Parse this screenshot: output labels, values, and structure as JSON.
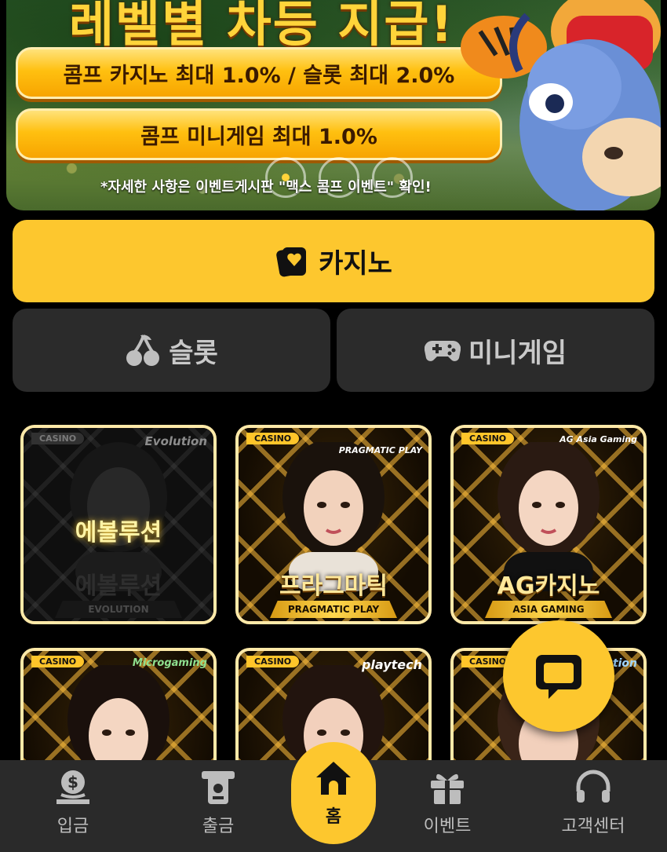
{
  "banner": {
    "title": "레벨별 차등 지급!",
    "pill_1": "콤프 카지노 최대 1.0% / 슬롯 최대 2.0%",
    "pill_2": "콤프 미니게임 최대 1.0%",
    "note": "*자세한 사항은 이벤트게시판 \"맥스 콤프 이벤트\" 확인!",
    "slide_count": 3,
    "active_slide": 1
  },
  "categories": {
    "casino": "카지노",
    "slot": "슬롯",
    "minigame": "미니게임"
  },
  "cards": [
    {
      "tag": "CASINO",
      "brand": "Evolution",
      "overlay": "에볼루션",
      "kname": "에볼루션",
      "ename": "EVOLUTION",
      "dimmed": true
    },
    {
      "tag": "CASINO",
      "brand": "PRAGMATIC PLAY",
      "kname": "프라그마틱",
      "ename": "PRAGMATIC PLAY",
      "dimmed": false
    },
    {
      "tag": "CASINO",
      "brand": "AG Asia Gaming",
      "kname": "AG카지노",
      "ename": "ASIA GAMING",
      "dimmed": false
    },
    {
      "tag": "CASINO",
      "brand": "Microgaming",
      "dimmed": false
    },
    {
      "tag": "CASINO",
      "brand": "playtech",
      "dimmed": false
    },
    {
      "tag": "CASINO",
      "brand": "ution",
      "dimmed": false
    }
  ],
  "nav": {
    "deposit": "입금",
    "withdraw": "출금",
    "home": "홈",
    "event": "이벤트",
    "support": "고객센터"
  },
  "colors": {
    "accent": "#fdc72e",
    "background": "#000000",
    "panel": "#2b2b2b",
    "nav_bg": "#2a2a2a"
  }
}
